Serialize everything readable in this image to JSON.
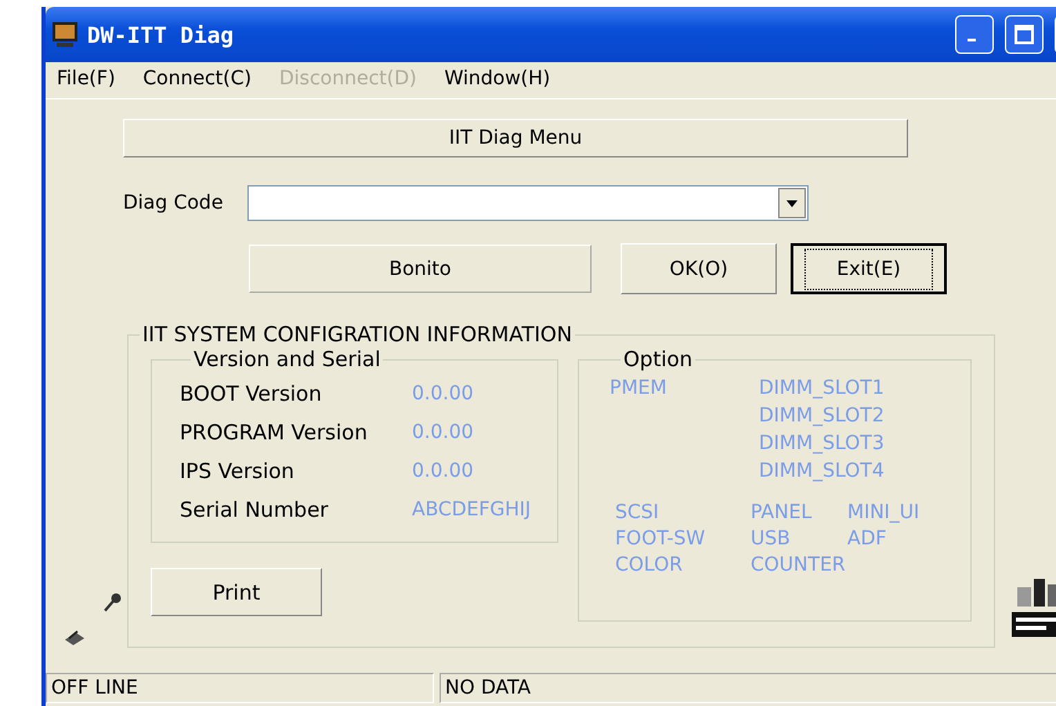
{
  "window": {
    "title": "DW-ITT Diag"
  },
  "menu": [
    {
      "label": "File(F)",
      "disabled": false
    },
    {
      "label": "Connect(C)",
      "disabled": false
    },
    {
      "label": "Disconnect(D)",
      "disabled": true
    },
    {
      "label": "Window(H)",
      "disabled": false
    }
  ],
  "menu_button": "IIT Diag Menu",
  "diag_code": {
    "label": "Diag Code"
  },
  "model_label": "Bonito",
  "buttons": [
    {
      "label": "OK(O)",
      "default": false
    },
    {
      "label": "Exit(E)",
      "default": true
    }
  ],
  "config": {
    "title": "IIT SYSTEM CONFIGRATION INFORMATION",
    "version_group": {
      "title": "Version and Serial",
      "rows": [
        {
          "label": "BOOT Version",
          "value": "0.0.00"
        },
        {
          "label": "PROGRAM Version",
          "value": "0.0.00"
        },
        {
          "label": "IPS Version",
          "value": "0.0.00"
        },
        {
          "label": "Serial Number",
          "value": "ABCDEFGHIJ"
        }
      ]
    },
    "option_group": {
      "title": "Option",
      "primary": "PMEM",
      "slots": [
        "DIMM_SLOT1",
        "DIMM_SLOT2",
        "DIMM_SLOT3",
        "DIMM_SLOT4"
      ],
      "items": [
        "SCSI",
        "PANEL",
        "MINI_UI",
        "FOOT-SW",
        "USB",
        "ADF",
        "COLOR",
        "COUNTER"
      ]
    },
    "print_button": "Print"
  },
  "status_bar": [
    "OFF LINE",
    "NO DATA"
  ]
}
